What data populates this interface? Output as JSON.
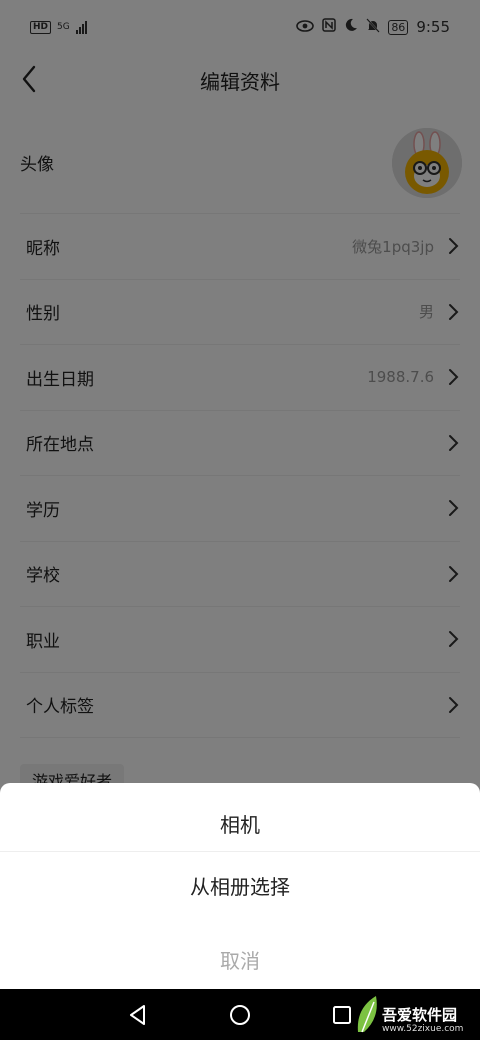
{
  "status_bar": {
    "hd": "HD",
    "network": "5G",
    "battery": "86",
    "time": "9:55"
  },
  "header": {
    "title": "编辑资料"
  },
  "profile": {
    "avatar_label": "头像",
    "rows": [
      {
        "label": "昵称",
        "value": "微兔1pq3jp"
      },
      {
        "label": "性别",
        "value": "男"
      },
      {
        "label": "出生日期",
        "value": "1988.7.6"
      },
      {
        "label": "所在地点",
        "value": ""
      },
      {
        "label": "学历",
        "value": ""
      },
      {
        "label": "学校",
        "value": ""
      },
      {
        "label": "职业",
        "value": ""
      },
      {
        "label": "个人标签",
        "value": ""
      }
    ],
    "tag": "游戏爱好者"
  },
  "action_sheet": {
    "option_camera": "相机",
    "option_album": "从相册选择",
    "cancel": "取消"
  },
  "watermark": {
    "text": "吾爱软件园",
    "url": "www.52zixue.com"
  },
  "colors": {
    "overlay": "#000000",
    "value_text": "#9a9a9a",
    "cancel_text": "#aaaaaa",
    "avatar_yellow": "#f2b300"
  }
}
